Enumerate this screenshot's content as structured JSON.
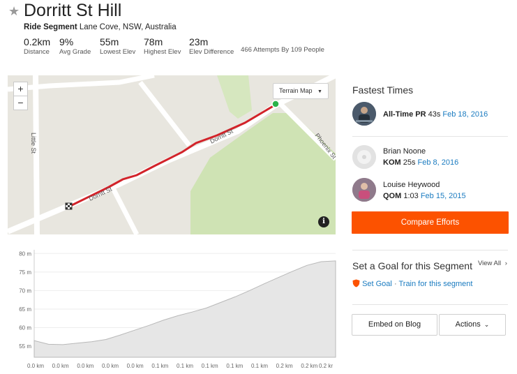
{
  "header": {
    "star_icon": "star-icon",
    "title": "Dorritt St Hill",
    "segment_type": "Ride Segment",
    "location": "Lane Cove, NSW, Australia",
    "attempts": "466 Attempts By 109 People"
  },
  "stats": [
    {
      "value": "0.2km",
      "label": "Distance"
    },
    {
      "value": "9%",
      "label": "Avg Grade"
    },
    {
      "value": "55m",
      "label": "Lowest Elev"
    },
    {
      "value": "78m",
      "label": "Highest Elev"
    },
    {
      "value": "23m",
      "label": "Elev Difference"
    }
  ],
  "map": {
    "zoom_in": "+",
    "zoom_out": "−",
    "map_type": "Terrain Map",
    "info_icon": "i",
    "street_labels": [
      "Little St",
      "Dorritt St",
      "Dorritt St",
      "Phoenix St"
    ],
    "colors": {
      "route": "#d2232a",
      "start": "#2ab34a",
      "park": "#cfe3b4",
      "road": "#ffffff",
      "land": "#e8e6df"
    }
  },
  "elevation_chart": {
    "y_ticks": [
      "80 m",
      "75 m",
      "70 m",
      "65 m",
      "60 m",
      "55 m"
    ],
    "x_ticks": [
      "0.0 km",
      "0.0 km",
      "0.0 km",
      "0.0 km",
      "0.0 km",
      "0.1 km",
      "0.1 km",
      "0.1 km",
      "0.1 km",
      "0.1 km",
      "0.2 km",
      "0.2 km"
    ],
    "last_tick": "0.2 kr"
  },
  "chart_data": {
    "type": "area",
    "x": [
      0.0,
      0.01,
      0.02,
      0.03,
      0.04,
      0.05,
      0.06,
      0.07,
      0.08,
      0.09,
      0.1,
      0.11,
      0.12,
      0.13,
      0.14,
      0.15,
      0.16,
      0.17,
      0.18,
      0.19,
      0.2,
      0.21
    ],
    "values": [
      56.5,
      55.5,
      55.4,
      55.8,
      56.2,
      56.8,
      58.0,
      59.3,
      60.6,
      62.0,
      63.2,
      64.2,
      65.3,
      66.8,
      68.3,
      70.0,
      71.8,
      73.5,
      75.2,
      76.8,
      77.8,
      78.0
    ],
    "ylim": [
      52,
      81
    ],
    "ylabel": "",
    "xlabel": ""
  },
  "sidebar": {
    "fastest_times_title": "Fastest Times",
    "pr": {
      "label": "All-Time PR",
      "time": "43s",
      "date": "Feb 18, 2016"
    },
    "kom": {
      "name": "Brian Noone",
      "label": "KOM",
      "time": "25s",
      "date": "Feb 8, 2016"
    },
    "qom": {
      "name": "Louise Heywood",
      "label": "QOM",
      "time": "1:03",
      "date": "Feb 15, 2015"
    },
    "compare_button": "Compare Efforts",
    "goal_title": "Set a Goal for this Segment",
    "view_all": "View All",
    "set_goal": "Set Goal",
    "separator": "·",
    "train": "Train for this segment",
    "embed_button": "Embed on Blog",
    "actions_button": "Actions",
    "accent_color": "#fc5200",
    "link_color": "#1a7bc0"
  }
}
